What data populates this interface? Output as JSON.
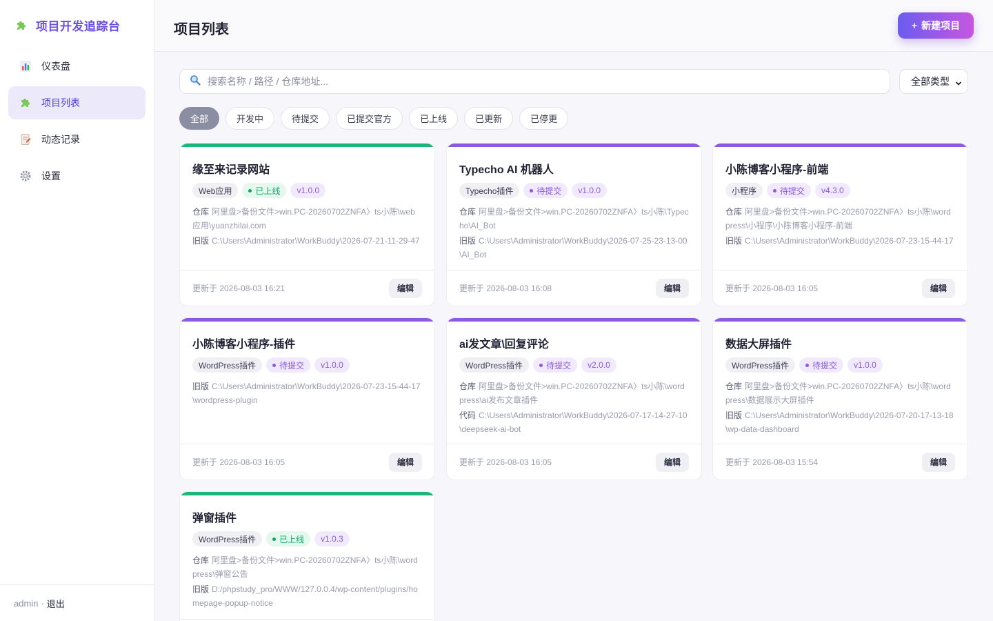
{
  "brand": {
    "title": "项目开发追踪台"
  },
  "nav": [
    {
      "label": "仪表盘",
      "icon": "bar-chart-icon",
      "active": false
    },
    {
      "label": "项目列表",
      "icon": "puzzle-icon",
      "active": true
    },
    {
      "label": "动态记录",
      "icon": "memo-icon",
      "active": false
    },
    {
      "label": "设置",
      "icon": "gear-icon",
      "active": false
    }
  ],
  "footer": {
    "user": "admin",
    "separator": "·",
    "logout": "退出"
  },
  "header": {
    "title": "项目列表",
    "new_button": "新建项目",
    "new_button_icon": "+"
  },
  "search": {
    "placeholder": "搜索名称 / 路径 / 仓库地址..."
  },
  "type_filter": {
    "selected": "全部类型"
  },
  "filters": [
    "全部",
    "开发中",
    "待提交",
    "已提交官方",
    "已上线",
    "已更新",
    "已停更"
  ],
  "colors": {
    "accent": "#6b5cf0",
    "online": "#1db57a",
    "pending": "#8b5ae0"
  },
  "cards": [
    {
      "title": "缘至来记录网站",
      "type": "Web应用",
      "status": "已上线",
      "status_kind": "online",
      "version": "v1.0.0",
      "paths": [
        {
          "key": "仓库",
          "value": "阿里盘>备份文件>win.PC-20260702ZNFA〉ts小陈\\web应用\\yuanzhilai.com"
        },
        {
          "key": "旧版",
          "value": "C:\\Users\\Administrator\\WorkBuddy\\2026-07-21-11-29-47"
        }
      ],
      "updated": "更新于 2026-08-03 16:21",
      "edit": "编辑"
    },
    {
      "title": "Typecho AI 机器人",
      "type": "Typecho插件",
      "status": "待提交",
      "status_kind": "pending",
      "version": "v1.0.0",
      "paths": [
        {
          "key": "仓库",
          "value": "阿里盘>备份文件>win.PC-20260702ZNFA〉ts小陈\\Typecho\\AI_Bot"
        },
        {
          "key": "旧版",
          "value": "C:\\Users\\Administrator\\WorkBuddy\\2026-07-25-23-13-00\\AI_Bot"
        }
      ],
      "updated": "更新于 2026-08-03 16:08",
      "edit": "编辑"
    },
    {
      "title": "小陈博客小程序-前端",
      "type": "小程序",
      "status": "待提交",
      "status_kind": "pending",
      "version": "v4.3.0",
      "paths": [
        {
          "key": "仓库",
          "value": "阿里盘>备份文件>win.PC-20260702ZNFA〉ts小陈\\wordpress\\小程序\\小陈博客小程序-前端"
        },
        {
          "key": "旧版",
          "value": "C:\\Users\\Administrator\\WorkBuddy\\2026-07-23-15-44-17"
        }
      ],
      "updated": "更新于 2026-08-03 16:05",
      "edit": "编辑"
    },
    {
      "title": "小陈博客小程序-插件",
      "type": "WordPress插件",
      "status": "待提交",
      "status_kind": "pending",
      "version": "v1.0.0",
      "paths": [
        {
          "key": "旧版",
          "value": "C:\\Users\\Administrator\\WorkBuddy\\2026-07-23-15-44-17\\wordpress-plugin"
        }
      ],
      "updated": "更新于 2026-08-03 16:05",
      "edit": "编辑"
    },
    {
      "title": "ai发文章\\回复评论",
      "type": "WordPress插件",
      "status": "待提交",
      "status_kind": "pending",
      "version": "v2.0.0",
      "paths": [
        {
          "key": "仓库",
          "value": "阿里盘>备份文件>win.PC-20260702ZNFA〉ts小陈\\wordpress\\ai发布文章插件"
        },
        {
          "key": "代码",
          "value": "C:\\Users\\Administrator\\WorkBuddy\\2026-07-17-14-27-10\\deepseek-ai-bot"
        }
      ],
      "updated": "更新于 2026-08-03 16:05",
      "edit": "编辑"
    },
    {
      "title": "数据大屏插件",
      "type": "WordPress插件",
      "status": "待提交",
      "status_kind": "pending",
      "version": "v1.0.0",
      "paths": [
        {
          "key": "仓库",
          "value": "阿里盘>备份文件>win.PC-20260702ZNFA〉ts小陈\\wordpress\\数据展示大屏插件"
        },
        {
          "key": "旧版",
          "value": "C:\\Users\\Administrator\\WorkBuddy\\2026-07-20-17-13-18\\wp-data-dashboard"
        }
      ],
      "updated": "更新于 2026-08-03 15:54",
      "edit": "编辑"
    },
    {
      "title": "弹窗插件",
      "type": "WordPress插件",
      "status": "已上线",
      "status_kind": "online",
      "version": "v1.0.3",
      "paths": [
        {
          "key": "仓库",
          "value": "阿里盘>备份文件>win.PC-20260702ZNFA〉ts小陈\\wordpress\\弹窗公告"
        },
        {
          "key": "旧版",
          "value": "D:/phpstudy_pro/WWW/127.0.0.4/wp-content/plugins/homepage-popup-notice"
        }
      ],
      "updated": "",
      "edit": ""
    }
  ]
}
